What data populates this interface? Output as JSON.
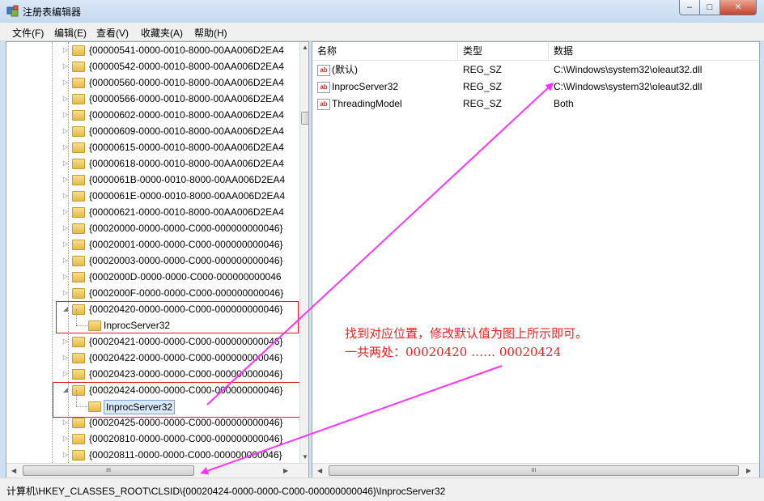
{
  "window": {
    "title": "注册表编辑器",
    "controls": {
      "minimize": "–",
      "maximize": "□",
      "close": "✕"
    }
  },
  "menu": [
    "文件(F)",
    "编辑(E)",
    "查看(V)",
    "收藏夹(A)",
    "帮助(H)"
  ],
  "tree": {
    "rows": [
      {
        "label": "{00000541-0000-0010-8000-00AA006D2EA4",
        "expander": "▷"
      },
      {
        "label": "{00000542-0000-0010-8000-00AA006D2EA4",
        "expander": "▷"
      },
      {
        "label": "{00000560-0000-0010-8000-00AA006D2EA4",
        "expander": "▷"
      },
      {
        "label": "{00000566-0000-0010-8000-00AA006D2EA4",
        "expander": "▷"
      },
      {
        "label": "{00000602-0000-0010-8000-00AA006D2EA4",
        "expander": "▷"
      },
      {
        "label": "{00000609-0000-0010-8000-00AA006D2EA4",
        "expander": "▷"
      },
      {
        "label": "{00000615-0000-0010-8000-00AA006D2EA4",
        "expander": "▷"
      },
      {
        "label": "{00000618-0000-0010-8000-00AA006D2EA4",
        "expander": "▷"
      },
      {
        "label": "{0000061B-0000-0010-8000-00AA006D2EA4",
        "expander": "▷"
      },
      {
        "label": "{0000061E-0000-0010-8000-00AA006D2EA4",
        "expander": "▷"
      },
      {
        "label": "{00000621-0000-0010-8000-00AA006D2EA4",
        "expander": "▷"
      },
      {
        "label": "{00020000-0000-0000-C000-000000000046}",
        "expander": "▷"
      },
      {
        "label": "{00020001-0000-0000-C000-000000000046}",
        "expander": "▷"
      },
      {
        "label": "{00020003-0000-0000-C000-000000000046}",
        "expander": "▷"
      },
      {
        "label": "{0002000D-0000-0000-C000-000000000046",
        "expander": "▷"
      },
      {
        "label": "{0002000F-0000-0000-C000-000000000046}",
        "expander": "▷"
      },
      {
        "label": "{00020420-0000-0000-C000-000000000046}",
        "expander": "◢"
      },
      {
        "label": "InprocServer32",
        "expander": "",
        "child": true
      },
      {
        "label": "{00020421-0000-0000-C000-000000000046}",
        "expander": "▷"
      },
      {
        "label": "{00020422-0000-0000-C000-000000000046}",
        "expander": "▷"
      },
      {
        "label": "{00020423-0000-0000-C000-000000000046}",
        "expander": "▷"
      },
      {
        "label": "{00020424-0000-0000-C000-000000000046}",
        "expander": "◢"
      },
      {
        "label": "InprocServer32",
        "expander": "",
        "child": true,
        "selected": true
      },
      {
        "label": "{00020425-0000-0000-C000-000000000046}",
        "expander": "▷"
      },
      {
        "label": "{00020810-0000-0000-C000-000000000046}",
        "expander": "▷"
      },
      {
        "label": "{00020811-0000-0000-C000-000000000046}",
        "expander": "▷"
      }
    ]
  },
  "list": {
    "columns": [
      "名称",
      "类型",
      "数据"
    ],
    "rows": [
      {
        "name": "(默认)",
        "type": "REG_SZ",
        "data": "C:\\Windows\\system32\\oleaut32.dll",
        "icon": "ab"
      },
      {
        "name": "InprocServer32",
        "type": "REG_SZ",
        "data": "C:\\Windows\\system32\\oleaut32.dll",
        "icon": "ab"
      },
      {
        "name": "ThreadingModel",
        "type": "REG_SZ",
        "data": "Both",
        "icon": "ab"
      }
    ]
  },
  "scroll": {
    "up": "▲",
    "down": "▼",
    "left": "◀",
    "right": "▶",
    "grip": "III"
  },
  "annotation": {
    "line1": "找到对应位置，修改默认值为图上所示即可。",
    "line2": "一共两处：00020420 …… 00020424",
    "color": "#ff1a1a",
    "arrow_color": "#ff33ff"
  },
  "status": {
    "path": "计算机\\HKEY_CLASSES_ROOT\\CLSID\\{00020424-0000-0000-C000-000000000046}\\InprocServer32"
  }
}
